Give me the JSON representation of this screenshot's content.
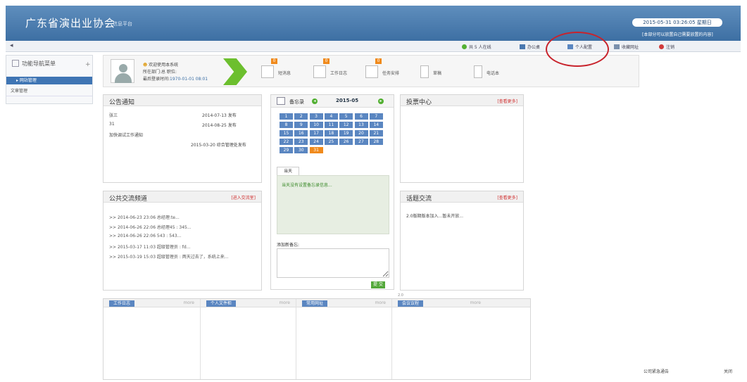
{
  "header": {
    "title": "广东省演出业协会",
    "subtitle": "信息平台",
    "datetime": "2015-05-31 03:26:05 星期日",
    "notice": "[本部分可以放置自己需要放置的内容]"
  },
  "toolbar": {
    "online": "共 5 人在线",
    "office": "办公桌",
    "profile": "个人配置",
    "favorites": "收藏网址",
    "logout": "注销"
  },
  "sidebar": {
    "title": "功能导航菜单",
    "items": [
      {
        "label": "网站管理",
        "active": true
      },
      {
        "label": "文章管理",
        "active": false
      }
    ]
  },
  "user": {
    "welcome": "欢迎使用本系统",
    "department": "所在部门:总 职位:",
    "last_login_label": "最后登录时间:",
    "last_login": "1970-01-01 08:01"
  },
  "quick": [
    {
      "label": "短消息",
      "badge": "0",
      "icon": "envelope-icon"
    },
    {
      "label": "工作日志",
      "badge": "0",
      "icon": "document-icon"
    },
    {
      "label": "任务安排",
      "badge": "0",
      "icon": "cloud-icon"
    },
    {
      "label": "草稿",
      "icon": "note-icon"
    },
    {
      "label": "电话本",
      "icon": "phonebook-icon"
    }
  ],
  "announcements": {
    "title": "公告通知",
    "items": [
      {
        "text": "张三",
        "date": "2014-07-13 发布"
      },
      {
        "text": "31",
        "date": "2014-08-25 发布"
      },
      {
        "text": "加快调试工作通知",
        "date": ""
      },
      {
        "text": "",
        "date": "2015-03-20 综合管理处发布"
      }
    ]
  },
  "public": {
    "title": "公共交流频道",
    "more": "[进入交流室]",
    "items": [
      ">> 2014-06-23 23:06 总经理:te...",
      ">> 2014-06-26 22:06 总经理45 : 345...",
      ">> 2014-06-26 22:06 543 : 543...",
      ">> 2015-03-17 11:03 超级管理员 : fd...",
      ">> 2015-03-19 15:03 超级管理员 : 两天过去了，系统上来..."
    ]
  },
  "calendar": {
    "title": "备忘录",
    "month": "2015-05",
    "days": [
      "1",
      "2",
      "3",
      "4",
      "5",
      "6",
      "7",
      "8",
      "9",
      "10",
      "11",
      "12",
      "13",
      "14",
      "15",
      "16",
      "17",
      "18",
      "19",
      "20",
      "21",
      "22",
      "23",
      "24",
      "25",
      "26",
      "27",
      "28",
      "29",
      "30",
      "31"
    ],
    "today": "31",
    "tab": "当天",
    "note": "当天没有设置备忘录信息...",
    "memo_label": "添加新备忘:",
    "submit": "提 交"
  },
  "vote": {
    "title": "投票中心",
    "more": "[查看更多]"
  },
  "topic": {
    "title": "话题交流",
    "more": "[查看更多]",
    "item": "2.0版期版本加入...暂未开放..."
  },
  "below_calendar": "2.0",
  "bottom_tabs": [
    {
      "label": "工作日志",
      "more": "more"
    },
    {
      "label": "个人文件柜",
      "more": "more"
    },
    {
      "label": "常用网址",
      "more": "more"
    },
    {
      "label": "会议议程",
      "more": "more"
    }
  ],
  "notify": {
    "title": "公司紧急通告",
    "close": "关闭"
  },
  "colors": {
    "header": "#4677aa",
    "accent": "#5a86c1",
    "today": "#f08a1c",
    "arrow": "#6cbf2e",
    "highlight_circle": "#c8232c"
  }
}
